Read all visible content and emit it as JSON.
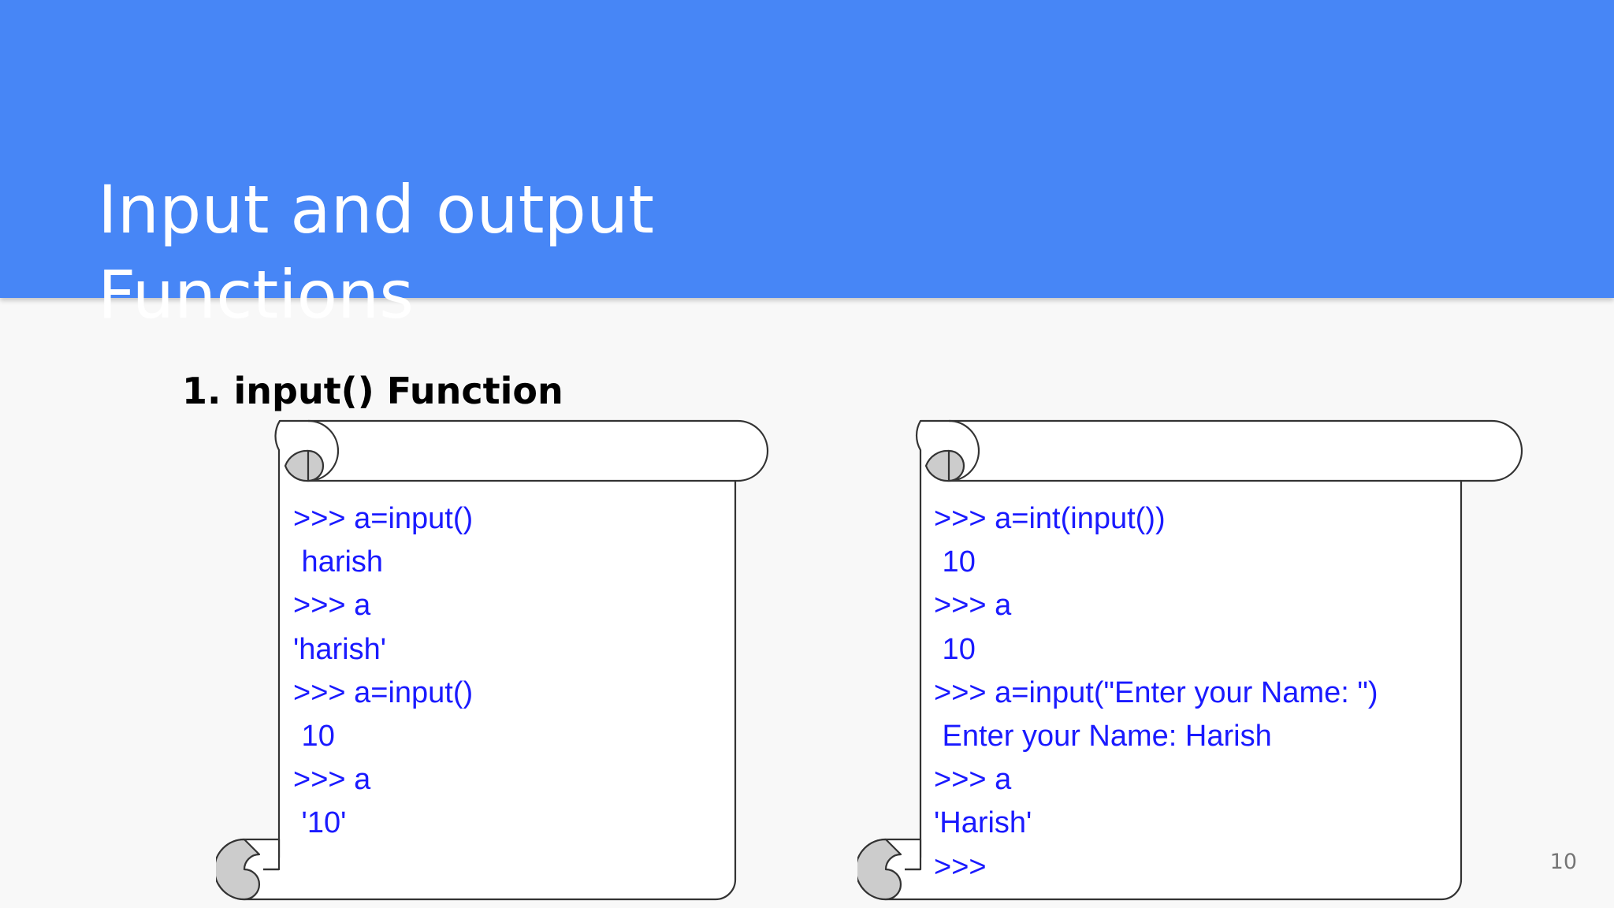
{
  "slide": {
    "title": "Input and output Functions",
    "section_heading": "1. input() Function",
    "page_number": "10"
  },
  "colors": {
    "header_bg": "#4786f6",
    "slide_bg": "#f8f8f8",
    "code_text": "#1a1aff",
    "scroll_curl": "#cccccc"
  },
  "icons": {
    "scroll_shape": "scroll-icon"
  },
  "scrolls": [
    {
      "lines": [
        ">>> a=input()",
        " harish",
        ">>> a",
        "'harish'",
        ">>> a=input()",
        " 10",
        ">>> a",
        " '10'"
      ]
    },
    {
      "lines": [
        ">>> a=int(input())",
        " 10",
        ">>> a",
        " 10",
        ">>> a=input(\"Enter your Name: \")",
        " Enter your Name: Harish",
        ">>> a",
        "'Harish'",
        ">>>"
      ]
    }
  ]
}
